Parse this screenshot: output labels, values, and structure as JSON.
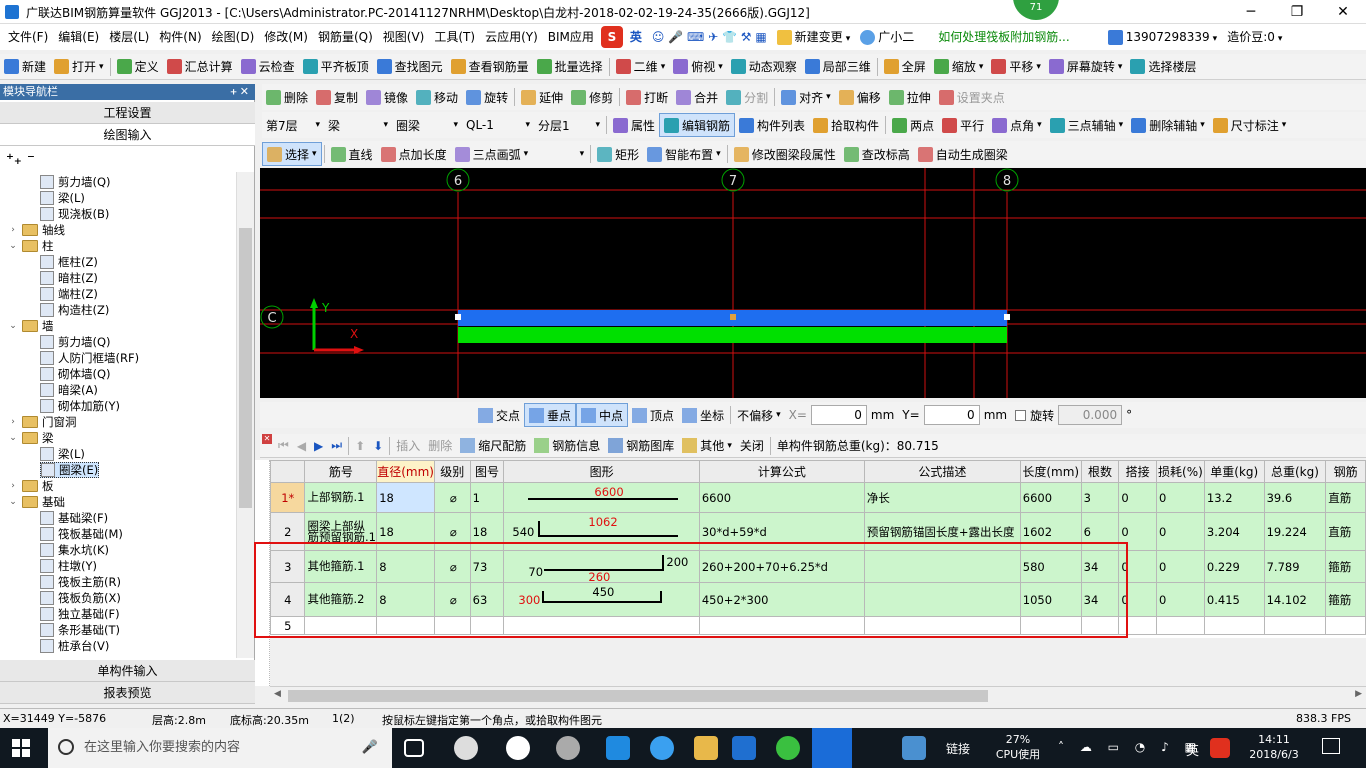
{
  "title": "广联达BIM钢筋算量软件 GGJ2013 - [C:\\Users\\Administrator.PC-20141127NRHM\\Desktop\\白龙村-2018-02-02-19-24-35(2666版).GGJ12]",
  "badge": "71",
  "menu": [
    "文件(F)",
    "编辑(E)",
    "楼层(L)",
    "构件(N)",
    "绘图(D)",
    "修改(M)",
    "钢筋量(Q)",
    "视图(V)",
    "工具(T)",
    "云应用(Y)",
    "BIM应用"
  ],
  "menu_right": {
    "ime": "英",
    "new_change": "新建变更",
    "assistant": "广小二",
    "help_link": "如何处理筏板附加钢筋...",
    "phone": "13907298339",
    "price": "造价豆:0"
  },
  "toolbar1": [
    "新建",
    "打开",
    "定义",
    "汇总计算",
    "云检查",
    "平齐板顶",
    "查找图元",
    "查看钢筋量",
    "批量选择",
    "二维",
    "俯视",
    "动态观察",
    "局部三维",
    "全屏",
    "缩放",
    "平移",
    "屏幕旋转",
    "选择楼层"
  ],
  "toolbar2": [
    "删除",
    "复制",
    "镜像",
    "移动",
    "旋转",
    "延伸",
    "修剪",
    "打断",
    "合并",
    "分割",
    "对齐",
    "偏移",
    "拉伸",
    "设置夹点"
  ],
  "toolbar3": {
    "floor": "第7层",
    "category": "梁",
    "type": "圈梁",
    "component": "QL-1",
    "layer": "分层1",
    "buttons": [
      "属性",
      "编辑钢筋",
      "构件列表",
      "拾取构件",
      "两点",
      "平行",
      "点角",
      "三点辅轴",
      "删除辅轴",
      "尺寸标注"
    ]
  },
  "toolbar4": [
    "选择",
    "直线",
    "点加长度",
    "三点画弧",
    "矩形",
    "智能布置",
    "修改圈梁段属性",
    "查改标高",
    "自动生成圈梁"
  ],
  "side": {
    "title": "模块导航栏",
    "btn_project": "工程设置",
    "btn_draw": "绘图输入",
    "btn_single": "单构件输入",
    "btn_report": "报表预览",
    "tree": [
      {
        "label": "剪力墙(Q)",
        "level": 2,
        "kind": "item"
      },
      {
        "label": "梁(L)",
        "level": 2,
        "kind": "item"
      },
      {
        "label": "现浇板(B)",
        "level": 2,
        "kind": "item"
      },
      {
        "label": "轴线",
        "level": 1,
        "kind": "folder",
        "exp": "›"
      },
      {
        "label": "柱",
        "level": 1,
        "kind": "folder",
        "exp": "⌄"
      },
      {
        "label": "框柱(Z)",
        "level": 2,
        "kind": "item"
      },
      {
        "label": "暗柱(Z)",
        "level": 2,
        "kind": "item"
      },
      {
        "label": "端柱(Z)",
        "level": 2,
        "kind": "item"
      },
      {
        "label": "构造柱(Z)",
        "level": 2,
        "kind": "item"
      },
      {
        "label": "墙",
        "level": 1,
        "kind": "folder",
        "exp": "⌄"
      },
      {
        "label": "剪力墙(Q)",
        "level": 2,
        "kind": "item"
      },
      {
        "label": "人防门框墙(RF)",
        "level": 2,
        "kind": "item"
      },
      {
        "label": "砌体墙(Q)",
        "level": 2,
        "kind": "item"
      },
      {
        "label": "暗梁(A)",
        "level": 2,
        "kind": "item"
      },
      {
        "label": "砌体加筋(Y)",
        "level": 2,
        "kind": "item"
      },
      {
        "label": "门窗洞",
        "level": 1,
        "kind": "folder",
        "exp": "›"
      },
      {
        "label": "梁",
        "level": 1,
        "kind": "folder",
        "exp": "⌄"
      },
      {
        "label": "梁(L)",
        "level": 2,
        "kind": "item"
      },
      {
        "label": "圈梁(E)",
        "level": 2,
        "kind": "item"
      },
      {
        "label": "板",
        "level": 1,
        "kind": "folder",
        "exp": "›"
      },
      {
        "label": "基础",
        "level": 1,
        "kind": "folder",
        "exp": "⌄"
      },
      {
        "label": "基础梁(F)",
        "level": 2,
        "kind": "item"
      },
      {
        "label": "筏板基础(M)",
        "level": 2,
        "kind": "item"
      },
      {
        "label": "集水坑(K)",
        "level": 2,
        "kind": "item"
      },
      {
        "label": "柱墩(Y)",
        "level": 2,
        "kind": "item"
      },
      {
        "label": "筏板主筋(R)",
        "level": 2,
        "kind": "item"
      },
      {
        "label": "筏板负筋(X)",
        "level": 2,
        "kind": "item"
      },
      {
        "label": "独立基础(F)",
        "level": 2,
        "kind": "item"
      },
      {
        "label": "条形基础(T)",
        "level": 2,
        "kind": "item"
      },
      {
        "label": "桩承台(V)",
        "level": 2,
        "kind": "item"
      }
    ]
  },
  "canvas": {
    "axis_labels": [
      "6",
      "7",
      "8",
      "C"
    ],
    "y_label": "Y",
    "x_label": "X"
  },
  "snapbar": {
    "items": [
      "交点",
      "垂点",
      "中点",
      "顶点",
      "坐标"
    ],
    "offset": "不偏移",
    "x_label": "X=",
    "x_value": "0",
    "y_label": "Y=",
    "y_value": "0",
    "unit": "mm",
    "rotate_label": "旋转",
    "rotate_value": "0.000",
    "degree": "°"
  },
  "tablebar": {
    "insert": "插入",
    "delete": "删除",
    "scale": "缩尺配筋",
    "info": "钢筋信息",
    "library": "钢筋图库",
    "other": "其他",
    "close": "关闭",
    "total": "单构件钢筋总重(kg)：80.715"
  },
  "columns": [
    "筋号",
    "直径(mm)",
    "级别",
    "图号",
    "图形",
    "计算公式",
    "公式描述",
    "长度(mm)",
    "根数",
    "搭接",
    "损耗(%)",
    "单重(kg)",
    "总重(kg)",
    "钢筋"
  ],
  "rows": [
    {
      "n": "1*",
      "name": "上部钢筋.1",
      "dia": "18",
      "grade": "⌀",
      "fig": "1",
      "shape_a": "6600",
      "shape_b": "",
      "shape_c": "",
      "formula": "6600",
      "desc": "净长",
      "len": "6600",
      "cnt": "3",
      "lap": "0",
      "loss": "0",
      "unit": "13.2",
      "total": "39.6",
      "type": "直筋"
    },
    {
      "n": "2",
      "name": "圈梁上部纵筋预留钢筋.1",
      "dia": "18",
      "grade": "⌀",
      "fig": "18",
      "shape_a": "1062",
      "shape_b": "540",
      "shape_c": "",
      "formula": "30*d+59*d",
      "desc": "预留钢筋锚固长度+露出长度",
      "len": "1602",
      "cnt": "6",
      "lap": "0",
      "loss": "0",
      "unit": "3.204",
      "total": "19.224",
      "type": "直筋"
    },
    {
      "n": "3",
      "name": "其他箍筋.1",
      "dia": "8",
      "grade": "⌀",
      "fig": "73",
      "shape_a": "260",
      "shape_b": "70",
      "shape_c": "200",
      "formula": "260+200+70+6.25*d",
      "desc": "",
      "len": "580",
      "cnt": "34",
      "lap": "0",
      "loss": "0",
      "unit": "0.229",
      "total": "7.789",
      "type": "箍筋"
    },
    {
      "n": "4",
      "name": "其他箍筋.2",
      "dia": "8",
      "grade": "⌀",
      "fig": "63",
      "shape_a": "450",
      "shape_b": "300",
      "shape_c": "",
      "formula": "450+2*300",
      "desc": "",
      "len": "1050",
      "cnt": "34",
      "lap": "0",
      "loss": "0",
      "unit": "0.415",
      "total": "14.102",
      "type": "箍筋"
    },
    {
      "n": "5",
      "name": "",
      "dia": "",
      "grade": "",
      "fig": "",
      "shape_a": "",
      "shape_b": "",
      "shape_c": "",
      "formula": "",
      "desc": "",
      "len": "",
      "cnt": "",
      "lap": "",
      "loss": "",
      "unit": "",
      "total": "",
      "type": ""
    }
  ],
  "status": {
    "coords": "X=31449 Y=-5876",
    "floor_h": "层高:2.8m",
    "base_h": "底标高:20.35m",
    "count": "1(2)",
    "hint": "按鼠标左键指定第一个角点，或拾取构件图元",
    "fps": "838.3 FPS"
  },
  "taskbar": {
    "search": "在这里输入你要搜索的内容",
    "link": "链接",
    "cpu": "27%",
    "cpu_label": "CPU使用",
    "ime": "英",
    "time": "14:11",
    "date": "2018/6/3"
  },
  "colors": {
    "beam_blue": "#1e6ef0",
    "beam_green": "#00e000",
    "axis_red": "#d01010",
    "highlight_red": "#e01010",
    "row_green": "#ccf5cc"
  }
}
